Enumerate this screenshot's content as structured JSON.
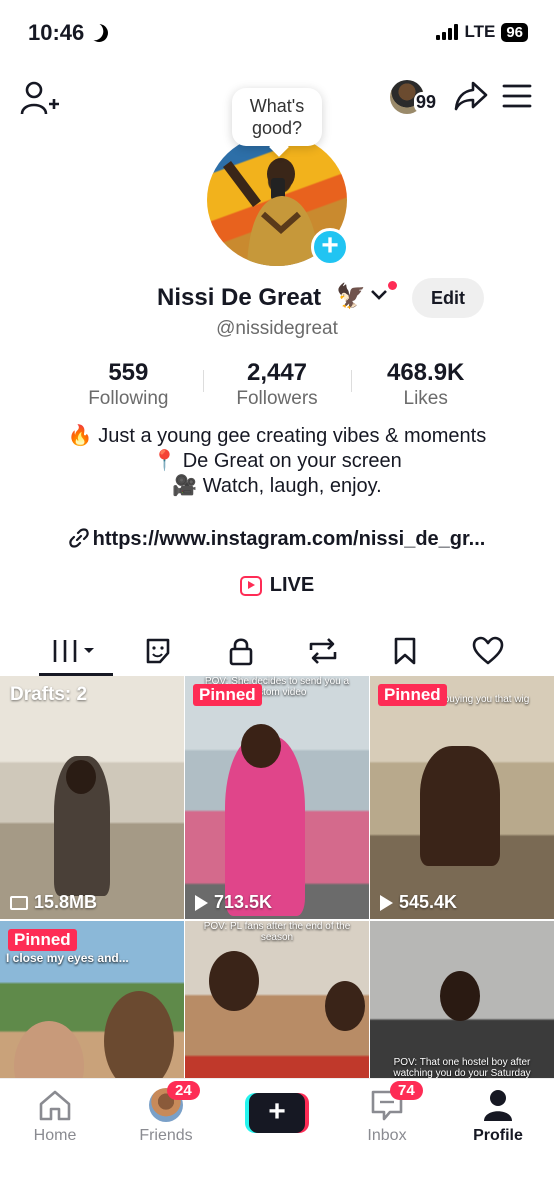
{
  "status_bar": {
    "time": "10:46",
    "network": "LTE",
    "battery": "96"
  },
  "header": {
    "visitor_count": "99"
  },
  "profile": {
    "bubble_text": "What's good?",
    "display_name": "Nissi De Great",
    "name_emoji": "🦅",
    "edit_label": "Edit",
    "username": "@nissidegreat"
  },
  "stats": [
    {
      "value": "559",
      "label": "Following"
    },
    {
      "value": "2,447",
      "label": "Followers"
    },
    {
      "value": "468.9K",
      "label": "Likes"
    }
  ],
  "bio": {
    "line1": "🔥 Just a young gee creating vibes & moments",
    "line2": "📍 De Great on your screen",
    "line3": "🎥 Watch, laugh, enjoy.",
    "link": "https://www.instagram.com/nissi_de_gr..."
  },
  "live_label": "LIVE",
  "tabs": [
    "videos-icon",
    "reposts-sticker-icon",
    "private-lock-icon",
    "repost-icon",
    "bookmark-icon",
    "liked-heart-icon"
  ],
  "grid": {
    "drafts_label": "Drafts: 2",
    "drafts_size": "15.8MB",
    "pinned_label": "Pinned",
    "v2_caption": "POV: She decides to send you a custom video",
    "v2_views": "713.5K",
    "v3_caption": "POV: after buying you that wig",
    "v3_views": "545.4K",
    "v4_caption": "I close my eyes and...",
    "v5_caption": "POV: PL fans after the end of the season",
    "v6_caption": "POV: That one hostel boy after watching you do your Saturday"
  },
  "bottom_nav": {
    "home": "Home",
    "friends": "Friends",
    "friends_badge": "24",
    "inbox": "Inbox",
    "inbox_badge": "74",
    "profile": "Profile"
  },
  "colors": {
    "accent": "#fe2c55",
    "cyan": "#25f4ee",
    "add_button": "#21c4f2"
  }
}
